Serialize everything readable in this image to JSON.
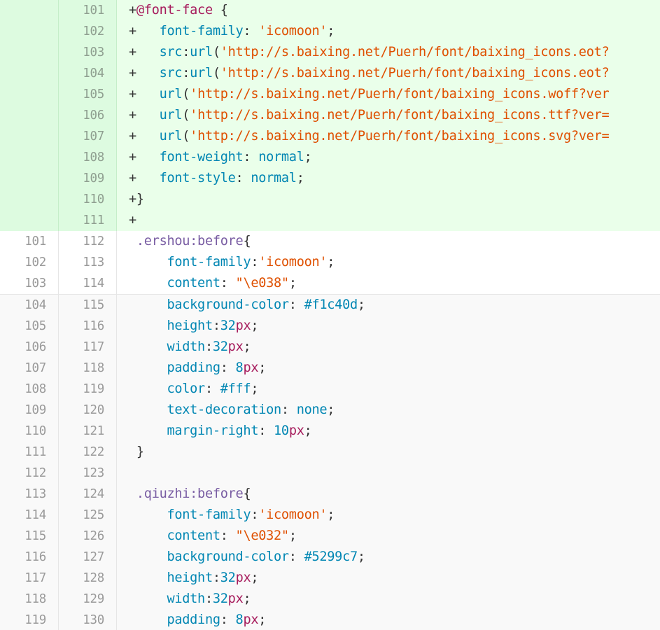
{
  "diff": {
    "lines": [
      {
        "type": "added",
        "old": "",
        "new": "101",
        "tokens": [
          [
            "plain",
            "+"
          ],
          [
            "at",
            "@font-face"
          ],
          [
            "plain",
            " {"
          ]
        ]
      },
      {
        "type": "added",
        "old": "",
        "new": "102",
        "tokens": [
          [
            "plain",
            "+   "
          ],
          [
            "prop",
            "font-family"
          ],
          [
            "plain",
            ": "
          ],
          [
            "str",
            "'icomoon'"
          ],
          [
            "plain",
            ";"
          ]
        ]
      },
      {
        "type": "added",
        "old": "",
        "new": "103",
        "tokens": [
          [
            "plain",
            "+   "
          ],
          [
            "prop",
            "src"
          ],
          [
            "plain",
            ":"
          ],
          [
            "prop",
            "url"
          ],
          [
            "plain",
            "("
          ],
          [
            "str",
            "'http://s.baixing.net/Puerh/font/baixing_icons.eot?"
          ]
        ]
      },
      {
        "type": "added",
        "old": "",
        "new": "104",
        "tokens": [
          [
            "plain",
            "+   "
          ],
          [
            "prop",
            "src"
          ],
          [
            "plain",
            ":"
          ],
          [
            "prop",
            "url"
          ],
          [
            "plain",
            "("
          ],
          [
            "str",
            "'http://s.baixing.net/Puerh/font/baixing_icons.eot?"
          ]
        ]
      },
      {
        "type": "added",
        "old": "",
        "new": "105",
        "tokens": [
          [
            "plain",
            "+   "
          ],
          [
            "prop",
            "url"
          ],
          [
            "plain",
            "("
          ],
          [
            "str",
            "'http://s.baixing.net/Puerh/font/baixing_icons.woff?ver"
          ]
        ]
      },
      {
        "type": "added",
        "old": "",
        "new": "106",
        "tokens": [
          [
            "plain",
            "+   "
          ],
          [
            "prop",
            "url"
          ],
          [
            "plain",
            "("
          ],
          [
            "str",
            "'http://s.baixing.net/Puerh/font/baixing_icons.ttf?ver="
          ]
        ]
      },
      {
        "type": "added",
        "old": "",
        "new": "107",
        "tokens": [
          [
            "plain",
            "+   "
          ],
          [
            "prop",
            "url"
          ],
          [
            "plain",
            "("
          ],
          [
            "str",
            "'http://s.baixing.net/Puerh/font/baixing_icons.svg?ver="
          ]
        ]
      },
      {
        "type": "added",
        "old": "",
        "new": "108",
        "tokens": [
          [
            "plain",
            "+   "
          ],
          [
            "prop",
            "font-weight"
          ],
          [
            "plain",
            ": "
          ],
          [
            "prop",
            "normal"
          ],
          [
            "plain",
            ";"
          ]
        ]
      },
      {
        "type": "added",
        "old": "",
        "new": "109",
        "tokens": [
          [
            "plain",
            "+   "
          ],
          [
            "prop",
            "font-style"
          ],
          [
            "plain",
            ": "
          ],
          [
            "prop",
            "normal"
          ],
          [
            "plain",
            ";"
          ]
        ]
      },
      {
        "type": "added",
        "old": "",
        "new": "110",
        "tokens": [
          [
            "plain",
            "+}"
          ]
        ]
      },
      {
        "type": "added",
        "old": "",
        "new": "111",
        "tokens": [
          [
            "plain",
            "+"
          ]
        ]
      },
      {
        "type": "context",
        "old": "101",
        "new": "112",
        "tokens": [
          [
            "plain",
            " "
          ],
          [
            "sel",
            ".ershou:before"
          ],
          [
            "plain",
            "{"
          ]
        ]
      },
      {
        "type": "context",
        "old": "102",
        "new": "113",
        "tokens": [
          [
            "plain",
            "     "
          ],
          [
            "prop",
            "font-family"
          ],
          [
            "plain",
            ":"
          ],
          [
            "str",
            "'icomoon'"
          ],
          [
            "plain",
            ";"
          ]
        ]
      },
      {
        "type": "context",
        "old": "103",
        "new": "114",
        "tokens": [
          [
            "plain",
            "     "
          ],
          [
            "prop",
            "content"
          ],
          [
            "plain",
            ": "
          ],
          [
            "str",
            "\"\\e038\""
          ],
          [
            "plain",
            ";"
          ]
        ]
      },
      {
        "type": "context-grey",
        "old": "104",
        "new": "115",
        "tokens": [
          [
            "plain",
            "     "
          ],
          [
            "prop",
            "background-color"
          ],
          [
            "plain",
            ": "
          ],
          [
            "num",
            "#f1c40d"
          ],
          [
            "plain",
            ";"
          ]
        ]
      },
      {
        "type": "context-grey",
        "old": "105",
        "new": "116",
        "tokens": [
          [
            "plain",
            "     "
          ],
          [
            "prop",
            "height"
          ],
          [
            "plain",
            ":"
          ],
          [
            "num",
            "32"
          ],
          [
            "unit",
            "px"
          ],
          [
            "plain",
            ";"
          ]
        ]
      },
      {
        "type": "context-grey",
        "old": "106",
        "new": "117",
        "tokens": [
          [
            "plain",
            "     "
          ],
          [
            "prop",
            "width"
          ],
          [
            "plain",
            ":"
          ],
          [
            "num",
            "32"
          ],
          [
            "unit",
            "px"
          ],
          [
            "plain",
            ";"
          ]
        ]
      },
      {
        "type": "context-grey",
        "old": "107",
        "new": "118",
        "tokens": [
          [
            "plain",
            "     "
          ],
          [
            "prop",
            "padding"
          ],
          [
            "plain",
            ": "
          ],
          [
            "num",
            "8"
          ],
          [
            "unit",
            "px"
          ],
          [
            "plain",
            ";"
          ]
        ]
      },
      {
        "type": "context-grey",
        "old": "108",
        "new": "119",
        "tokens": [
          [
            "plain",
            "     "
          ],
          [
            "prop",
            "color"
          ],
          [
            "plain",
            ": "
          ],
          [
            "num",
            "#fff"
          ],
          [
            "plain",
            ";"
          ]
        ]
      },
      {
        "type": "context-grey",
        "old": "109",
        "new": "120",
        "tokens": [
          [
            "plain",
            "     "
          ],
          [
            "prop",
            "text-decoration"
          ],
          [
            "plain",
            ": "
          ],
          [
            "prop",
            "none"
          ],
          [
            "plain",
            ";"
          ]
        ]
      },
      {
        "type": "context-grey",
        "old": "110",
        "new": "121",
        "tokens": [
          [
            "plain",
            "     "
          ],
          [
            "prop",
            "margin-right"
          ],
          [
            "plain",
            ": "
          ],
          [
            "num",
            "10"
          ],
          [
            "unit",
            "px"
          ],
          [
            "plain",
            ";"
          ]
        ]
      },
      {
        "type": "context-grey",
        "old": "111",
        "new": "122",
        "tokens": [
          [
            "plain",
            " }"
          ]
        ]
      },
      {
        "type": "context-grey",
        "old": "112",
        "new": "123",
        "tokens": [
          [
            "plain",
            ""
          ]
        ]
      },
      {
        "type": "context-grey",
        "old": "113",
        "new": "124",
        "tokens": [
          [
            "plain",
            " "
          ],
          [
            "sel",
            ".qiuzhi:before"
          ],
          [
            "plain",
            "{"
          ]
        ]
      },
      {
        "type": "context-grey",
        "old": "114",
        "new": "125",
        "tokens": [
          [
            "plain",
            "     "
          ],
          [
            "prop",
            "font-family"
          ],
          [
            "plain",
            ":"
          ],
          [
            "str",
            "'icomoon'"
          ],
          [
            "plain",
            ";"
          ]
        ]
      },
      {
        "type": "context-grey",
        "old": "115",
        "new": "126",
        "tokens": [
          [
            "plain",
            "     "
          ],
          [
            "prop",
            "content"
          ],
          [
            "plain",
            ": "
          ],
          [
            "str",
            "\"\\e032\""
          ],
          [
            "plain",
            ";"
          ]
        ]
      },
      {
        "type": "context-grey",
        "old": "116",
        "new": "127",
        "tokens": [
          [
            "plain",
            "     "
          ],
          [
            "prop",
            "background-color"
          ],
          [
            "plain",
            ": "
          ],
          [
            "num",
            "#5299c7"
          ],
          [
            "plain",
            ";"
          ]
        ]
      },
      {
        "type": "context-grey",
        "old": "117",
        "new": "128",
        "tokens": [
          [
            "plain",
            "     "
          ],
          [
            "prop",
            "height"
          ],
          [
            "plain",
            ":"
          ],
          [
            "num",
            "32"
          ],
          [
            "unit",
            "px"
          ],
          [
            "plain",
            ";"
          ]
        ]
      },
      {
        "type": "context-grey",
        "old": "118",
        "new": "129",
        "tokens": [
          [
            "plain",
            "     "
          ],
          [
            "prop",
            "width"
          ],
          [
            "plain",
            ":"
          ],
          [
            "num",
            "32"
          ],
          [
            "unit",
            "px"
          ],
          [
            "plain",
            ";"
          ]
        ]
      },
      {
        "type": "context-grey",
        "old": "119",
        "new": "130",
        "tokens": [
          [
            "plain",
            "     "
          ],
          [
            "prop",
            "padding"
          ],
          [
            "plain",
            ": "
          ],
          [
            "num",
            "8"
          ],
          [
            "unit",
            "px"
          ],
          [
            "plain",
            ";"
          ]
        ]
      }
    ]
  },
  "colors": {
    "added_bg": "#eaffea",
    "added_gutter_bg": "#ddfbe0",
    "context_bg": "#ffffff",
    "line_number": "#9a9a9a",
    "property": "#0086b3",
    "string": "#df5000",
    "selector": "#795da3",
    "at_rule": "#a71d5d"
  }
}
